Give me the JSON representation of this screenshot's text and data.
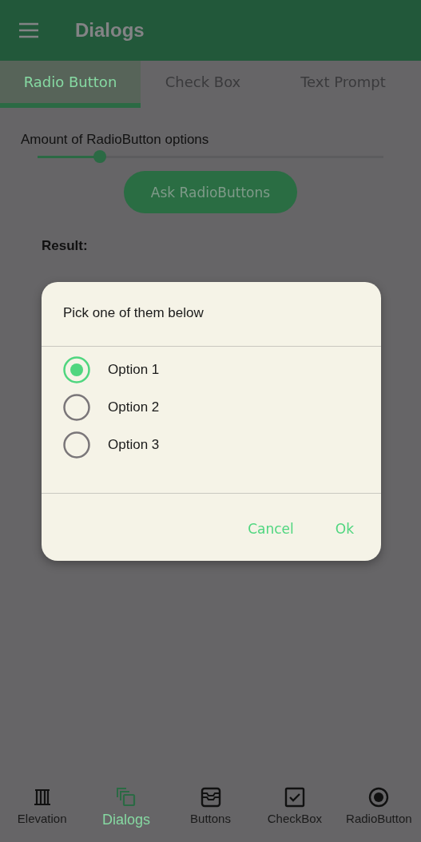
{
  "app_bar": {
    "title": "Dialogs"
  },
  "tabs": [
    {
      "label": "Radio Button",
      "selected": true
    },
    {
      "label": "Check Box",
      "selected": false
    },
    {
      "label": "Text Prompt",
      "selected": false
    }
  ],
  "slider": {
    "label": "Amount of RadioButton options",
    "level": 0.18
  },
  "ask_button": "Ask RadioButtons",
  "result_label": "Result:",
  "dialog": {
    "title": "Pick one of them below",
    "options": [
      {
        "label": "Option 1",
        "selected": true
      },
      {
        "label": "Option 2",
        "selected": false
      },
      {
        "label": "Option 3",
        "selected": false
      }
    ],
    "buttons": [
      "Cancel",
      "Ok"
    ]
  },
  "bottom_nav": [
    {
      "kind": "columns",
      "label": "Elevation",
      "selected": false
    },
    {
      "kind": "layers",
      "label": "Dialogs",
      "selected": true
    },
    {
      "kind": "tray",
      "label": "Buttons",
      "selected": false
    },
    {
      "kind": "checkbox",
      "label": "CheckBox",
      "selected": false
    },
    {
      "kind": "radio",
      "label": "RadioButton",
      "selected": false
    }
  ]
}
